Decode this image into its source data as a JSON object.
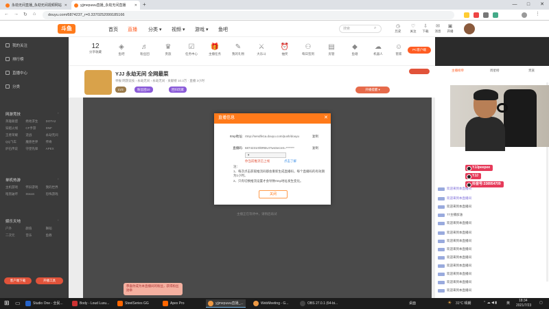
{
  "browser": {
    "tabs": [
      {
        "label": "永劫无间直播_永劫无间视频网站"
      },
      {
        "label": "yjjmepuwu直播_永劫无间直播"
      }
    ],
    "url": "douyu.com/6874237_r=0.3370252099185166",
    "new_tab": "+",
    "win_controls": [
      "—",
      "□",
      "✕"
    ]
  },
  "header": {
    "logo": "斗鱼",
    "nav": [
      "首页",
      "直播",
      "分类 ▾",
      "视频 ▾",
      "游戏 ▾",
      "鱼吧"
    ],
    "nav_selected": 1,
    "search_placeholder": "搜索",
    "icons": [
      {
        "label": "历史",
        "icon": "history-icon"
      },
      {
        "label": "关注",
        "icon": "follow-icon"
      },
      {
        "label": "下载",
        "icon": "download-icon"
      },
      {
        "label": "消息",
        "icon": "message-icon"
      },
      {
        "label": "开播",
        "icon": "broadcast-icon"
      }
    ]
  },
  "sidebar": {
    "items": [
      "我的关注",
      "排行榜",
      "直播中心",
      "分类"
    ],
    "sections": [
      {
        "title": "网游竞技",
        "games": [
          "英雄联盟",
          "绝地求生",
          "DOTA2",
          "穿越火线",
          "CF手游",
          "DNF",
          "王者荣耀",
          "逆战",
          "永劫无间",
          "QQ飞车",
          "魔兽世界",
          "传奇",
          "炉石传说",
          "守望先锋",
          "APEX"
        ]
      },
      {
        "title": "单机热游",
        "games": [
          "主机游戏",
          "怀旧游戏",
          "我的世界",
          "暗黑破坏",
          "Steam",
          "恐怖游戏"
        ]
      },
      {
        "title": "娱乐天地",
        "games": [
          "户外",
          "颜值",
          "舞蹈",
          "二次元",
          "音乐",
          "鱼教"
        ]
      }
    ],
    "buttons": [
      "客户端下载",
      "开播工具"
    ]
  },
  "categories": {
    "count": "12",
    "count_label": "分享收藏",
    "items": [
      "鱼吧",
      "粉丝团",
      "贵族",
      "任务中心",
      "主播任务",
      "我的礼物",
      "大乐斗",
      "抽奖",
      "每日签到",
      "房管",
      "鱼塘",
      "机器人",
      "管家",
      "抽奖",
      "优惠券",
      "直播间",
      "更多"
    ],
    "pc_button": "PC客户端"
  },
  "room": {
    "title": "YJJ 永劫无间 全网最菜",
    "meta": "举报  网游竞技 › 永劫无间 › 永劫无间  ·  贡献榜  10.3万  ·  直播 3小时",
    "tags": [
      "LV3",
      "粉丝团10",
      "回归玩家"
    ],
    "tip_button": "开播提醒 ▾",
    "hint": "主播正在等待中，请稍后再试"
  },
  "modal": {
    "title": "直播信息",
    "close": "✕",
    "rtmp_label": "rtmp地址:",
    "rtmp_value": "rtmp://sendfe1a.douyu.com/push/douyu",
    "stream_label": "直播码:",
    "stream_value": "6874231r0l0RBv4?wsSecret=*******",
    "copy_label": "复制",
    "select_value": "",
    "warning": "你当前推流已上线",
    "help_link": "点击了解",
    "notes_title": "注：",
    "notes": [
      "1、每次点击获取推流码都会重新生成直播码，每个直播码的有效期为1小时。",
      "2、只有切换推流设置才会导致rtmp地址发生变化。"
    ],
    "ok_button": "关闭"
  },
  "cam": {
    "badges": [
      "YJJpeepee",
      "YJJ",
      "抖音号:338954709"
    ]
  },
  "chat": {
    "tabs": [
      "主播榜单",
      "周星榜",
      "贵族"
    ],
    "lines": [
      "欢迎来到本直播间",
      "欢迎来到本直播间",
      "欢迎来到本直播间",
      "欢迎来到本直播间",
      "77主播加油",
      "欢迎来到本直播间",
      "欢迎来到本直播间",
      "欢迎来到本直播间",
      "欢迎来到本直播间",
      "欢迎来到本直播间",
      "欢迎来到本直播间",
      "欢迎来到本直播间",
      "欢迎来到本直播间",
      "欢迎来到本直播间"
    ]
  },
  "toast": "恭喜你成为本直播间的粉丝，获得粉丝勋章",
  "taskbar": {
    "items": [
      "Studio One - 全民...",
      "Body - Loud Luxu...",
      "SteelSeries GG",
      "Apex Pro",
      "yjjmepuwu直播_...",
      "WebMeeting - G...",
      "OBS 27.0.1 (64-bi..."
    ],
    "weather": "31°C 晴朗",
    "ime": "英",
    "time": "18:34",
    "date": "2021/7/23"
  }
}
